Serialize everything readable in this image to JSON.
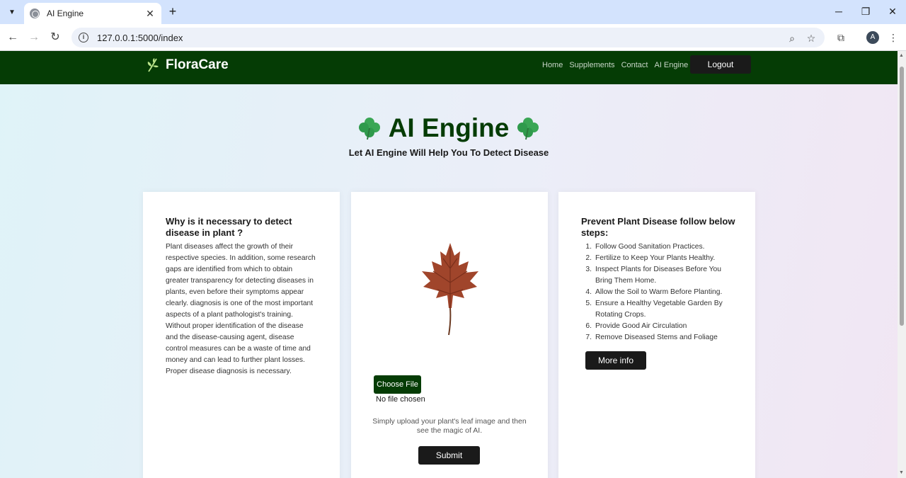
{
  "browser": {
    "tab_title": "AI Engine",
    "url": "127.0.0.1:5000/index",
    "new_tab": "+",
    "tab_close": "✕",
    "avatar_letter": "A"
  },
  "navbar": {
    "brand": "FloraCare",
    "links": [
      "Home",
      "Supplements",
      "Contact",
      "AI Engine"
    ],
    "logout_label": "Logout"
  },
  "hero": {
    "title": "AI Engine",
    "subtitle": "Let AI Engine Will Help You To Detect Disease"
  },
  "left_card": {
    "heading": "Why is it necessary to detect disease in plant ?",
    "body": "Plant diseases affect the growth of their respective species. In addition, some research gaps are identified from which to obtain greater transparency for detecting diseases in plants, even before their symptoms appear clearly. diagnosis is one of the most important aspects of a plant pathologist's training. Without proper identification of the disease and the disease-causing agent, disease control measures can be a waste of time and money and can lead to further plant losses. Proper disease diagnosis is necessary."
  },
  "upload_card": {
    "choose_file_label": "Choose File",
    "no_file_text": "No file chosen",
    "hint": "Simply upload your plant's leaf image and then see the magic of AI.",
    "submit_label": "Submit"
  },
  "right_card": {
    "heading": "Prevent Plant Disease follow below steps:",
    "steps": [
      {
        "num": "1.",
        "text": "Follow Good Sanitation Practices."
      },
      {
        "num": "2.",
        "text": "Fertilize to Keep Your Plants Healthy."
      },
      {
        "num": "3.",
        "text": "Inspect Plants for Diseases Before You Bring Them Home."
      },
      {
        "num": "4.",
        "text": "Allow the Soil to Warm Before Planting."
      },
      {
        "num": "5.",
        "text": "Ensure a Healthy Vegetable Garden By Rotating Crops."
      },
      {
        "num": "6.",
        "text": "Provide Good Air Circulation"
      },
      {
        "num": "7.",
        "text": "Remove Diseased Stems and Foliage"
      }
    ],
    "more_info_label": "More info"
  },
  "colors": {
    "navbar_bg": "#053c05",
    "title_color": "#053c05",
    "button_dark": "#1a1a1a",
    "leaf": "#a0452b"
  }
}
